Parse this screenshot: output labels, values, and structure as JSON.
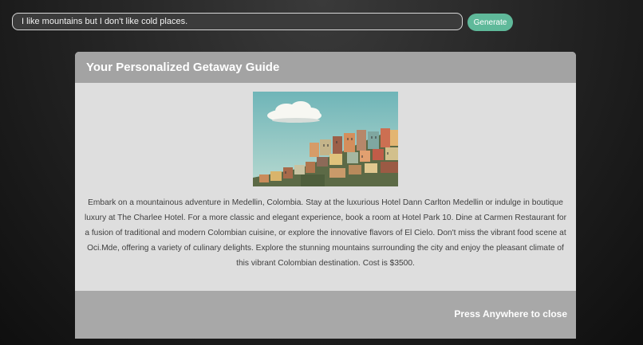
{
  "prompt": {
    "value": "I like mountains but I don't like cold places.",
    "button_label": "Generate"
  },
  "modal": {
    "title": "Your Personalized Getaway Guide",
    "image_subject": "cloud-over-colorful-hillside-houses",
    "description": "Embark on a mountainous adventure in Medellin, Colombia. Stay at the luxurious Hotel Dann Carlton Medellin or indulge in boutique luxury at The Charlee Hotel. For a more classic and elegant experience, book a room at Hotel Park 10. Dine at Carmen Restaurant for a fusion of traditional and modern Colombian cuisine, or explore the innovative flavors of El Cielo. Don't miss the vibrant food scene at Oci.Mde, offering a variety of culinary delights. Explore the stunning mountains surrounding the city and enjoy the pleasant climate of this vibrant Colombian destination. Cost is $3500.",
    "close_label": "Press Anywhere to close"
  },
  "colors": {
    "accent": "#5fb99a",
    "modal_header": "#a3a3a3",
    "modal_body": "#dedede"
  }
}
